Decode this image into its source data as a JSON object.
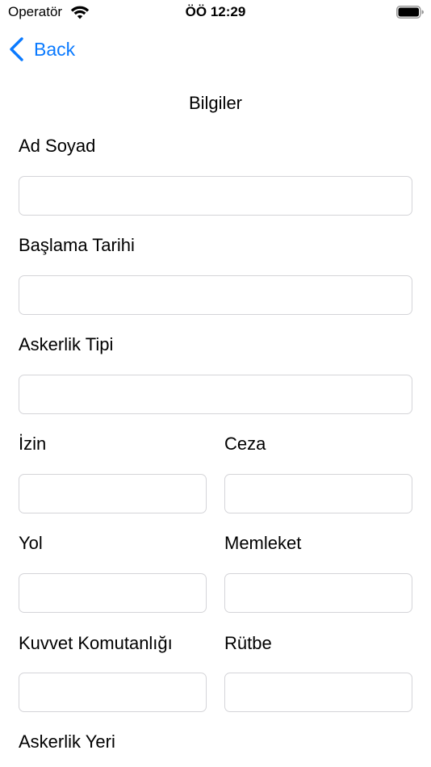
{
  "status_bar": {
    "carrier": "Operatör",
    "time": "ÖÖ 12:29",
    "wifi_icon": "wifi-icon",
    "battery_icon": "battery-full-icon"
  },
  "nav": {
    "back_label": "Back",
    "back_icon": "chevron-left-icon",
    "accent_color": "#0a7aff"
  },
  "title": "Bilgiler",
  "fields": {
    "ad_soyad": {
      "label": "Ad Soyad",
      "value": ""
    },
    "baslama_tarihi": {
      "label": "Başlama Tarihi",
      "value": ""
    },
    "askerlik_tipi": {
      "label": "Askerlik Tipi",
      "value": ""
    },
    "izin": {
      "label": "İzin",
      "value": ""
    },
    "ceza": {
      "label": "Ceza",
      "value": ""
    },
    "yol": {
      "label": "Yol",
      "value": ""
    },
    "memleket": {
      "label": "Memleket",
      "value": ""
    },
    "kuvvet_komutanligi": {
      "label": "Kuvvet Komutanlığı",
      "value": ""
    },
    "rutbe": {
      "label": "Rütbe",
      "value": ""
    },
    "askerlik_yeri": {
      "label": "Askerlik Yeri",
      "value": ""
    }
  }
}
